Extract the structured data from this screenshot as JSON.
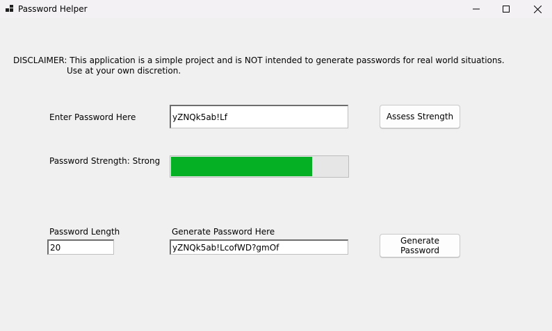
{
  "window": {
    "title": "Password Helper",
    "icons": {
      "app": "app-icon",
      "minimize": "minimize-icon",
      "maximize": "maximize-icon",
      "close": "close-icon"
    }
  },
  "disclaimer": {
    "line1": "DISCLAIMER: This application is a simple project and is NOT intended to generate passwords for real world situations.",
    "line2": "Use at your own discretion."
  },
  "assess": {
    "input_label": "Enter Password Here",
    "input_value": "yZNQk5ab!Lf",
    "button_label": "Assess Strength"
  },
  "strength": {
    "label": "Password Strength: Strong",
    "progress_fraction": 0.8,
    "bar_color": "#06b025"
  },
  "generate": {
    "length_label": "Password Length",
    "length_value": "20",
    "output_label": "Generate Password Here",
    "output_value": "yZNQk5ab!LcofWD?gmOf",
    "button_label": "Generate Password"
  }
}
